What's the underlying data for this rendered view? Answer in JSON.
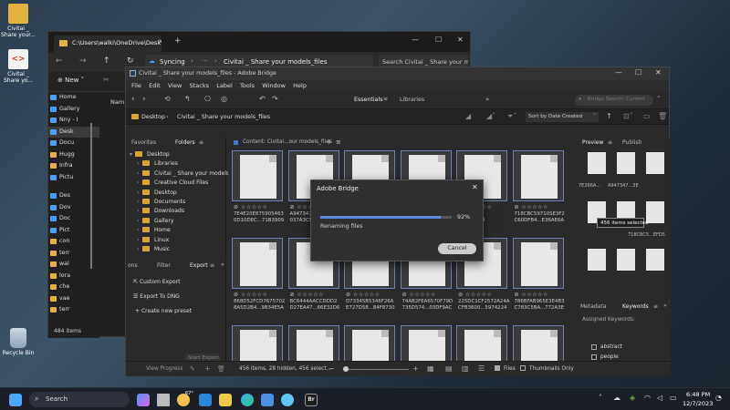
{
  "desktop": {
    "icons": [
      {
        "label": "Civitai _ Share your..."
      },
      {
        "label": "Civitai _ Share yo..."
      },
      {
        "label": "Recycle Bin"
      }
    ]
  },
  "explorer": {
    "tab_title": "C:\\Users\\walki\\OneDrive\\Desk",
    "address_sync": "Syncing",
    "address_folder": "Civitai _ Share your models_files",
    "search_placeholder": "Search Civitai _ Share your mo",
    "new_label": "New",
    "nav_items": [
      "Home",
      "Gallery",
      "Nny - I",
      "Desk",
      "Docu",
      "Hugg",
      "Infra",
      "Pictu",
      "Des",
      "Dov",
      "Doc",
      "Pict",
      "con",
      "terr",
      "wal",
      "lora",
      "che",
      "vae",
      "terr"
    ],
    "column_header": "Nam",
    "item_count": "484 items"
  },
  "bridge": {
    "window_title": "Civitai _ Share your models_files - Adobe Bridge",
    "menu": [
      "File",
      "Edit",
      "View",
      "Stacks",
      "Label",
      "Tools",
      "Window",
      "Help"
    ],
    "workspaces": {
      "essentials": "Essentials",
      "libraries": "Libraries"
    },
    "search_placeholder": "Bridge Search: Current",
    "breadcrumb": [
      "Desktop",
      "Civitai _ Share your models_files"
    ],
    "sort_label": "Sort by Date Created",
    "left_tabs": {
      "favorites": "Favorites",
      "folders": "Folders"
    },
    "folder_tree": [
      "Desktop",
      "Libraries",
      "Civitai _ Share your models",
      "Creative Cloud Files",
      "Desktop",
      "Documents",
      "Downloads",
      "Gallery",
      "Home",
      "Linux",
      "Music"
    ],
    "filter_tabs": {
      "collections": "ons",
      "filter": "Filter",
      "export": "Export"
    },
    "export_items": [
      "Custom Export",
      "Export To DNG",
      "Create new preset"
    ],
    "start_export": "Start Export",
    "view_progress": "View Progress",
    "content_label": "Content: Civitai...our models_files",
    "thumbs": [
      {
        "name": "7E4E20E875905463 0D10DEC...71B3909"
      },
      {
        "name": "A947347... 037A3C5..."
      },
      {
        "name": ""
      },
      {
        "name": ""
      },
      {
        "name": "...6CD34D ...528504B"
      },
      {
        "name": "718CBC59710SE3F2 C60DFB4...E36AE6A"
      },
      {
        "name": "868D52FCD7675702 8A5D2B4...9B34E5A"
      },
      {
        "name": "BC6444AACCDDD2 D27EA47...66E32D6"
      },
      {
        "name": "D73345B5346F26A E727D58...84F8730"
      },
      {
        "name": "74AB2FEA6570F79D 735D574...03DF9AC"
      },
      {
        "name": "225DC1CF2572A24A CFB3600...5974224"
      },
      {
        "name": "786BFAB965E3E4B3 C783C5BA...772A3E"
      },
      {
        "name": ""
      },
      {
        "name": ""
      },
      {
        "name": ""
      },
      {
        "name": ""
      },
      {
        "name": ""
      },
      {
        "name": ""
      }
    ],
    "status_text": "456 items, 28 hidden, 456 select...",
    "right_tabs": {
      "preview": "Preview",
      "publish": "Publish"
    },
    "preview_names": [
      "7E266A...",
      "A947347...3E",
      "718CBC5...EFD5"
    ],
    "tooltip": "456 items selected",
    "meta_tabs": {
      "metadata": "Metadata",
      "keywords": "Keywords"
    },
    "assigned_keywords": "Assigned Keywords:",
    "keywords": [
      "abstract",
      "people"
    ],
    "filter_toggle": "Files",
    "thumbnails_only": "Thumbnails Only"
  },
  "dialog": {
    "title": "Adobe Bridge",
    "progress_percent": "92%",
    "progress_fraction": 0.92,
    "status": "Renaming files",
    "cancel_label": "Cancel"
  },
  "taskbar": {
    "search_label": "Search",
    "weather": "67°",
    "time": "6:48 PM",
    "date": "12/7/2023"
  },
  "colors": {
    "accent": "#4a9eff",
    "bridge_thumb_border": "#6c7fb8",
    "progress": "#5b8be0"
  }
}
